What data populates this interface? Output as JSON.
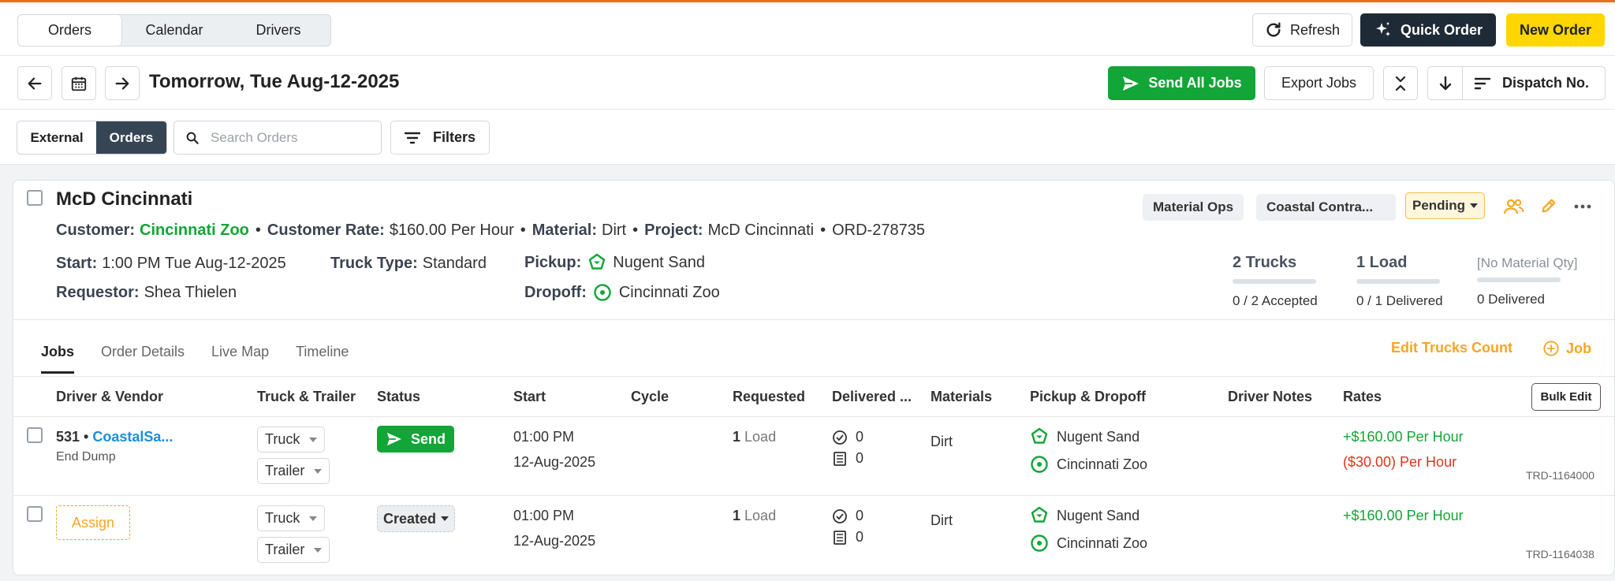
{
  "top": {
    "tabs": [
      "Orders",
      "Calendar",
      "Drivers"
    ],
    "refresh": "Refresh",
    "quick_order": "Quick Order",
    "new_order": "New Order"
  },
  "datebar": {
    "title": "Tomorrow, Tue Aug-12-2025",
    "send_all": "Send All Jobs",
    "export": "Export Jobs",
    "dispatch": "Dispatch No."
  },
  "filter": {
    "seg": [
      "External",
      "Orders"
    ],
    "search_placeholder": "Search Orders",
    "filters": "Filters"
  },
  "order": {
    "title": "McD Cincinnati",
    "customer_label": "Customer:",
    "customer": "Cincinnati Zoo",
    "rate_label": "Customer Rate:",
    "rate": "$160.00 Per Hour",
    "material_label": "Material:",
    "material": "Dirt",
    "project_label": "Project:",
    "project": "McD Cincinnati",
    "order_no": "ORD-278735",
    "start_label": "Start:",
    "start": "1:00 PM Tue Aug-12-2025",
    "truck_type_label": "Truck Type:",
    "truck_type": "Standard",
    "requestor_label": "Requestor:",
    "requestor": "Shea Thielen",
    "pickup_label": "Pickup:",
    "pickup": "Nugent Sand",
    "dropoff_label": "Dropoff:",
    "dropoff": "Cincinnati Zoo",
    "tag1": "Material Ops",
    "tag2": "Coastal Contra...",
    "status": "Pending",
    "stats": {
      "trucks": "2 Trucks",
      "trucks_sub": "0 / 2 Accepted",
      "loads": "1 Load",
      "loads_sub": "0 / 1 Delivered",
      "qty": "[No Material Qty]",
      "qty_sub": "0 Delivered"
    }
  },
  "tabs": [
    "Jobs",
    "Order Details",
    "Live Map",
    "Timeline"
  ],
  "actions": {
    "edit_trucks": "Edit Trucks Count",
    "add_job": "Job"
  },
  "table": {
    "headers": [
      "Driver & Vendor",
      "Truck & Trailer",
      "Status",
      "Start",
      "Cycle",
      "Requested",
      "Delivered ...",
      "Materials",
      "Pickup & Dropoff",
      "Driver Notes",
      "Rates"
    ],
    "bulk_edit": "Bulk Edit",
    "rows": [
      {
        "driver": "531 •",
        "vendor": "CoastalSa...",
        "truck_kind": "End Dump",
        "truck": "Truck",
        "trailer": "Trailer",
        "status": "Send",
        "start_time": "01:00 PM",
        "start_date": "12-Aug-2025",
        "req_num": "1",
        "req_unit": "Load",
        "delivered": "0",
        "tickets": "0",
        "material": "Dirt",
        "pickup": "Nugent Sand",
        "dropoff": "Cincinnati Zoo",
        "rate1": "+$160.00 Per Hour",
        "rate2": "($30.00) Per Hour",
        "trd": "TRD-1164000"
      },
      {
        "assign": "Assign",
        "truck": "Truck",
        "trailer": "Trailer",
        "status": "Created",
        "start_time": "01:00 PM",
        "start_date": "12-Aug-2025",
        "req_num": "1",
        "req_unit": "Load",
        "delivered": "0",
        "tickets": "0",
        "material": "Dirt",
        "pickup": "Nugent Sand",
        "dropoff": "Cincinnati Zoo",
        "rate1": "+$160.00 Per Hour",
        "trd": "TRD-1164038"
      }
    ]
  }
}
